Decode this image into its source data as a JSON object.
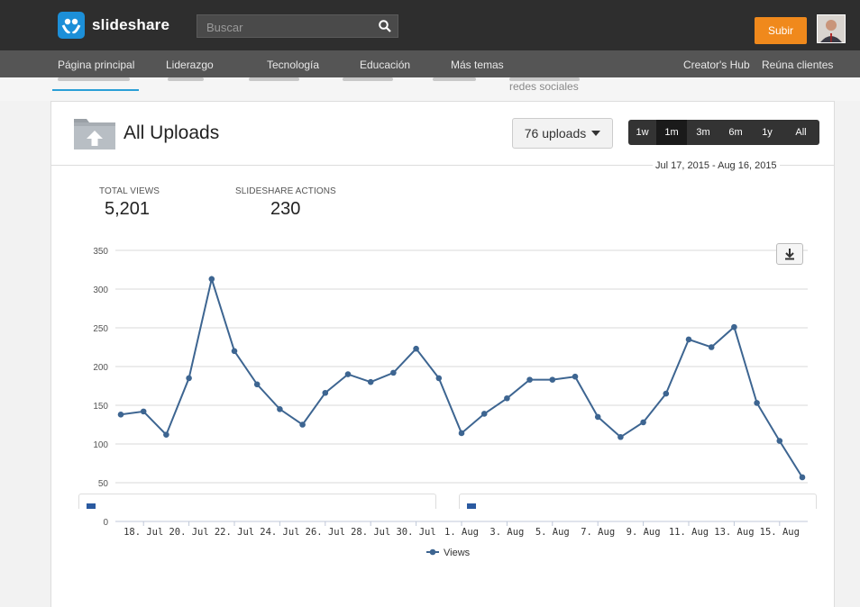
{
  "header": {
    "brand": "slideshare",
    "search_placeholder": "Buscar",
    "upload_label": "Subir"
  },
  "nav": {
    "left": [
      "Página principal",
      "Liderazgo",
      "Tecnología",
      "Educación",
      "Más temas"
    ],
    "right": [
      "Creator's Hub",
      "Reúna clientes"
    ]
  },
  "subtabs": {
    "partial_label": "redes sociales"
  },
  "card": {
    "title": "All Uploads",
    "uploads_dropdown": "76 uploads",
    "ranges": [
      "1w",
      "1m",
      "3m",
      "6m",
      "1y",
      "All"
    ],
    "active_range": "1m",
    "date_range": "Jul 17, 2015 - Aug 16, 2015"
  },
  "stats": [
    {
      "label": "TOTAL VIEWS",
      "value": "5,201"
    },
    {
      "label": "SLIDESHARE ACTIONS",
      "value": "230"
    }
  ],
  "chart_data": {
    "type": "line",
    "y_ticks": [
      0,
      50,
      100,
      150,
      200,
      250,
      300,
      350
    ],
    "ylim": [
      0,
      350
    ],
    "x_tick_labels": [
      "18. Jul",
      "20. Jul",
      "22. Jul",
      "24. Jul",
      "26. Jul",
      "28. Jul",
      "30. Jul",
      "1. Aug",
      "3. Aug",
      "5. Aug",
      "7. Aug",
      "9. Aug",
      "11. Aug",
      "13. Aug",
      "15. Aug"
    ],
    "grid": true,
    "legend_position": "bottom-center",
    "series": [
      {
        "name": "Views",
        "color": "#3d6591",
        "x": [
          "Jul 17",
          "Jul 18",
          "Jul 19",
          "Jul 20",
          "Jul 21",
          "Jul 22",
          "Jul 23",
          "Jul 24",
          "Jul 25",
          "Jul 26",
          "Jul 27",
          "Jul 28",
          "Jul 29",
          "Jul 30",
          "Jul 31",
          "Aug 1",
          "Aug 2",
          "Aug 3",
          "Aug 4",
          "Aug 5",
          "Aug 6",
          "Aug 7",
          "Aug 8",
          "Aug 9",
          "Aug 10",
          "Aug 11",
          "Aug 12",
          "Aug 13",
          "Aug 14",
          "Aug 15",
          "Aug 16"
        ],
        "values": [
          138,
          142,
          112,
          185,
          313,
          220,
          177,
          145,
          125,
          166,
          190,
          180,
          192,
          223,
          185,
          114,
          139,
          159,
          183,
          183,
          187,
          135,
          109,
          128,
          165,
          235,
          225,
          251,
          153,
          104,
          57
        ]
      }
    ]
  }
}
